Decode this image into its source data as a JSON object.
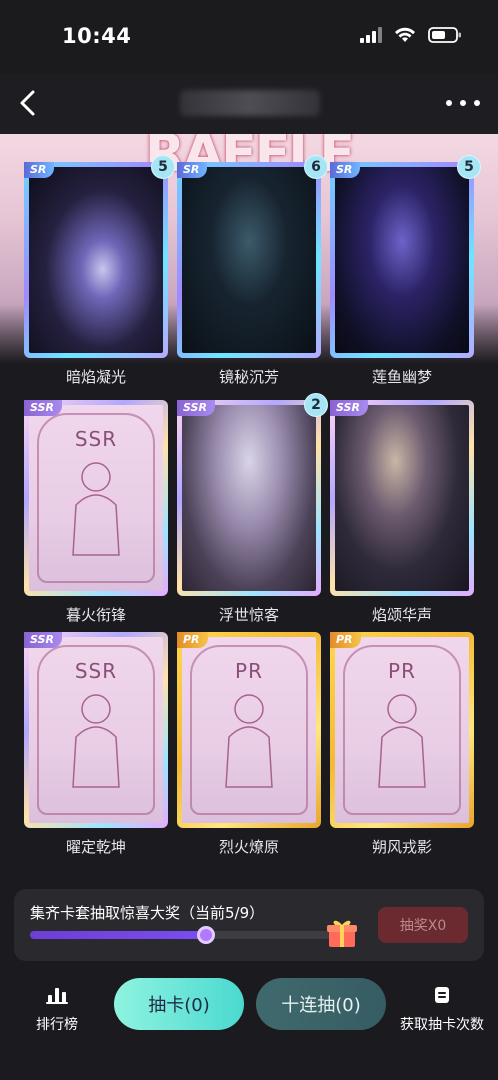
{
  "status_bar": {
    "time": "10:44"
  },
  "nav": {
    "title": ""
  },
  "banner": {
    "decor_text": "RAFFLE"
  },
  "cards": [
    {
      "rarity": "SR",
      "name": "暗焰凝光",
      "count": "5",
      "art": "art-lotus",
      "locked": false,
      "locked_label": ""
    },
    {
      "rarity": "SR",
      "name": "镜秘沉芳",
      "count": "6",
      "art": "art-dark2",
      "locked": false,
      "locked_label": ""
    },
    {
      "rarity": "SR",
      "name": "莲鱼幽梦",
      "count": "5",
      "art": "art-dark",
      "locked": false,
      "locked_label": ""
    },
    {
      "rarity": "SSR",
      "name": "暮火衔锋",
      "count": "",
      "art": "art-locked",
      "locked": true,
      "locked_label": "SSR"
    },
    {
      "rarity": "SSR",
      "name": "浮世惊客",
      "count": "2",
      "art": "art-portrait1",
      "locked": false,
      "locked_label": ""
    },
    {
      "rarity": "SSR",
      "name": "焰颂华声",
      "count": "",
      "art": "art-portrait2",
      "locked": false,
      "locked_label": ""
    },
    {
      "rarity": "SSR",
      "name": "曜定乾坤",
      "count": "",
      "art": "art-locked",
      "locked": true,
      "locked_label": "SSR"
    },
    {
      "rarity": "PR",
      "name": "烈火燎原",
      "count": "",
      "art": "art-locked",
      "locked": true,
      "locked_label": "PR"
    },
    {
      "rarity": "PR",
      "name": "朔风戎影",
      "count": "",
      "art": "art-locked",
      "locked": true,
      "locked_label": "PR"
    }
  ],
  "progress": {
    "title": "集齐卡套抽取惊喜大奖（当前5/9）",
    "current": 5,
    "total": 9,
    "fraction": 0.556,
    "draw_label": "抽奖X0",
    "fill_color": "#7b4cf0"
  },
  "bottom": {
    "rank_label": "排行榜",
    "draw_one_label": "抽卡(0)",
    "draw_ten_label": "十连抽(0)",
    "get_count_label": "获取抽卡次数"
  },
  "icons": {
    "back": "chevron-left-icon",
    "more": "more-icon",
    "gift": "gift-icon",
    "rank": "bar-chart-icon",
    "get": "document-icon"
  }
}
